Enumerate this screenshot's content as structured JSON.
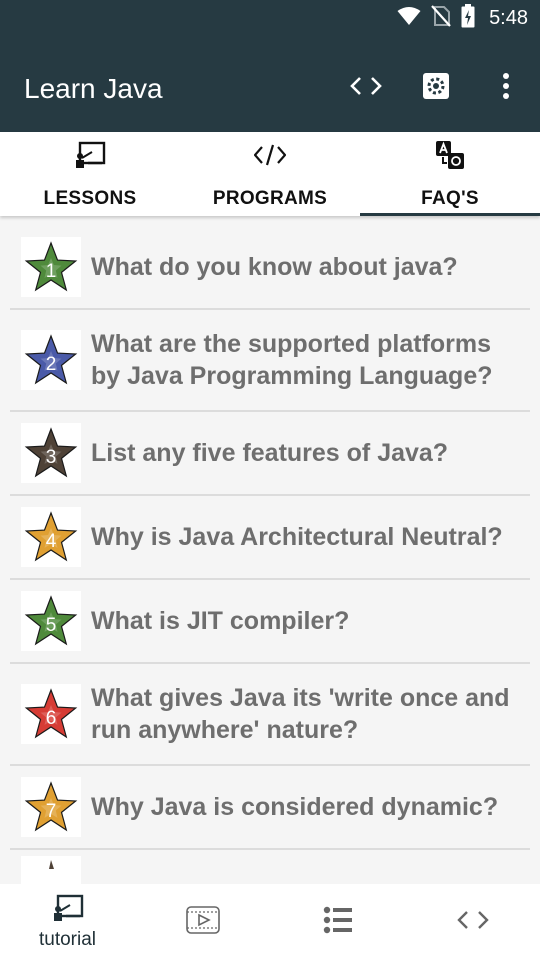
{
  "status_bar": {
    "time": "5:48"
  },
  "app_bar": {
    "title": "Learn Java",
    "actions": [
      "code-icon",
      "settings-icon",
      "more-vert-icon"
    ]
  },
  "tabs": [
    {
      "label": "LESSONS",
      "icon": "lessons-icon",
      "active": false
    },
    {
      "label": "PROGRAMS",
      "icon": "code-icon",
      "active": false
    },
    {
      "label": "FAQ'S",
      "icon": "translate-icon",
      "active": true
    }
  ],
  "faqs": [
    {
      "number": "1",
      "color": "#4f8a3b",
      "question": "What do you know about java?"
    },
    {
      "number": "2",
      "color": "#4a5aa8",
      "question": "What are the supported platforms by Java Programming Language?"
    },
    {
      "number": "3",
      "color": "#4f4237",
      "question": "List any five features of Java?"
    },
    {
      "number": "4",
      "color": "#e0a032",
      "question": "Why is Java Architectural Neutral?"
    },
    {
      "number": "5",
      "color": "#4f8a3b",
      "question": "What is JIT compiler?"
    },
    {
      "number": "6",
      "color": "#d63c35",
      "question": "What gives Java its 'write once and run anywhere' nature?"
    },
    {
      "number": "7",
      "color": "#e0a032",
      "question": "Why Java is considered dynamic?"
    }
  ],
  "bottom_nav": [
    {
      "label": "tutorial",
      "icon": "lessons-icon",
      "active": true
    },
    {
      "label": "",
      "icon": "video-icon",
      "active": false
    },
    {
      "label": "",
      "icon": "list-icon",
      "active": false
    },
    {
      "label": "",
      "icon": "code-icon",
      "active": false
    }
  ]
}
